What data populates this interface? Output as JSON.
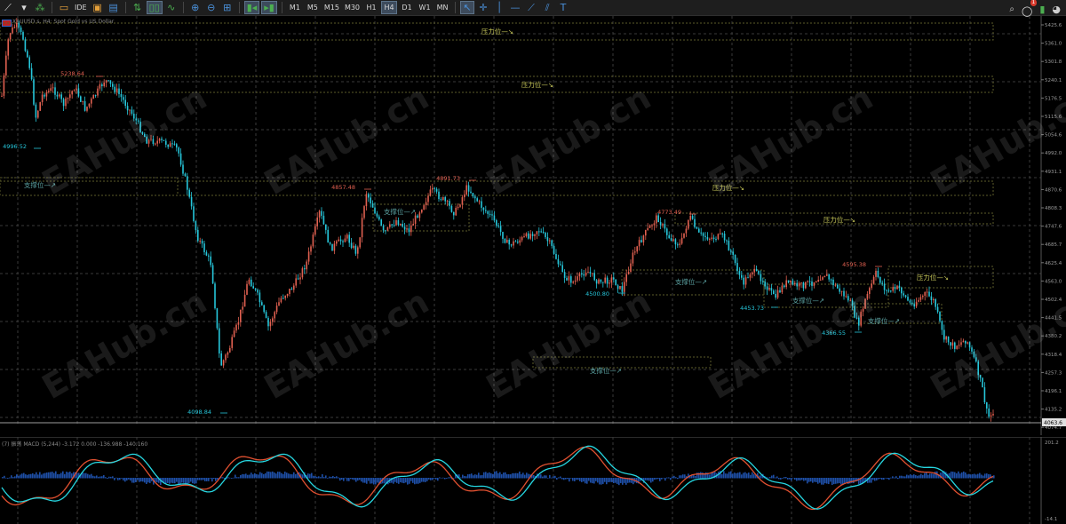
{
  "toolbar": {
    "tools_left": [
      "chart-line-icon",
      "dropdown-icon",
      "grab-icon",
      "folder-icon"
    ],
    "ide_label": "IDE",
    "timeframes": [
      "M1",
      "M5",
      "M15",
      "M30",
      "H1",
      "H4",
      "D1",
      "W1",
      "MN"
    ],
    "active_timeframe": "H4",
    "notification_count": "1"
  },
  "chart": {
    "symbol_line": "XAUUSD.s, H4: Spot Gold vs US Dollar",
    "current_price": "4063.6",
    "price_axis": [
      "5425.6",
      "5361.0",
      "5301.8",
      "5240.1",
      "5176.5",
      "5115.6",
      "5054.6",
      "4992.0",
      "4931.1",
      "4870.6",
      "4808.3",
      "4747.6",
      "4685.7",
      "4625.4",
      "4563.0",
      "4502.4",
      "4441.5",
      "4380.2",
      "4318.4",
      "4257.3",
      "4196.1",
      "4135.2",
      "4074.7"
    ],
    "price_colors": {
      "bull": "#e06050",
      "bear": "#26c6da",
      "grid": "#3a3a3a",
      "zone": "#b0b060"
    },
    "price_labels": [
      {
        "text": "5238.64",
        "color": "#e06050"
      },
      {
        "text": "4996.52",
        "color": "#26c6da"
      },
      {
        "text": "4857.48",
        "color": "#e06050"
      },
      {
        "text": "4891.73",
        "color": "#e06050"
      },
      {
        "text": "4773.49",
        "color": "#e06050"
      },
      {
        "text": "4500.80",
        "color": "#26c6da"
      },
      {
        "text": "4453.73",
        "color": "#26c6da"
      },
      {
        "text": "4595.38",
        "color": "#e06050"
      },
      {
        "text": "4366.55",
        "color": "#26c6da"
      },
      {
        "text": "4098.84",
        "color": "#26c6da"
      }
    ],
    "resistance_label": "压力位—↘",
    "support_label": "支撑位—↗",
    "watermark": "EAHub.cn"
  },
  "macd": {
    "label": "(7) 振荡 MACD (5,244) -3.172  0.000 -136.988 -140.160",
    "axis": [
      "201.2",
      "-14.1"
    ]
  }
}
